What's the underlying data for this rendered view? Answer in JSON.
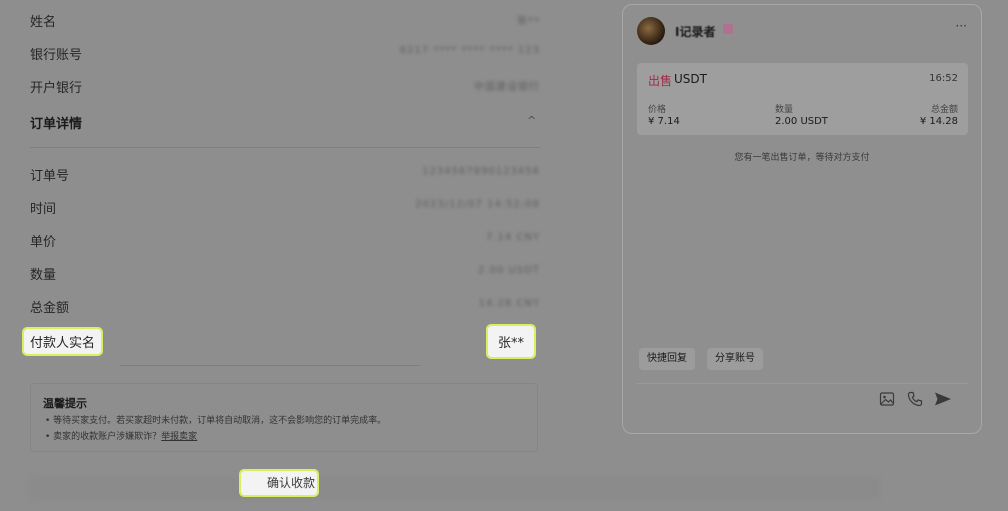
{
  "details": {
    "name": {
      "label": "姓名",
      "value": "张**"
    },
    "bank_account": {
      "label": "银行账号",
      "value": "6217 **** **** **** 123"
    },
    "bank": {
      "label": "开户银行",
      "value": "中国建设银行"
    }
  },
  "order_section": {
    "title": "订单详情",
    "chevron": "^"
  },
  "order": {
    "number": {
      "label": "订单号",
      "value": "1234567890123456"
    },
    "time": {
      "label": "时间",
      "value": "2023/12/07 14:52:08"
    },
    "price": {
      "label": "单价",
      "value": "7.14 CNY"
    },
    "quantity": {
      "label": "数量",
      "value": "2.00 USDT"
    },
    "total": {
      "label": "总金额",
      "value": "14.28 CNY"
    },
    "payer": {
      "label": "付款人实名",
      "value": "张**"
    }
  },
  "tips": {
    "title": "温馨提示",
    "line1": "• 等待买家支付。若买家超时未付款，订单将自动取消，这不会影响您的订单完成率。",
    "line2_prefix": "• 卖家的收款账户涉嫌欺诈？",
    "line2_link": "举报卖家"
  },
  "confirm_button": "确认收款",
  "chat": {
    "user_name": "I记录者",
    "more": "···",
    "order_card": {
      "side": "出售",
      "coin": "USDT",
      "time": "16:52",
      "price_label": "价格",
      "price_value": "¥ 7.14",
      "qty_label": "数量",
      "qty_value": "2.00 USDT",
      "total_label": "总金额",
      "total_value": "¥ 14.28"
    },
    "notice": "您有一笔出售订单，等待对方支付",
    "quick_reply": "快捷回复",
    "share_account": "分享账号"
  },
  "colors": {
    "sell_accent": "#a02a4a",
    "highlight": "#d7f062"
  }
}
